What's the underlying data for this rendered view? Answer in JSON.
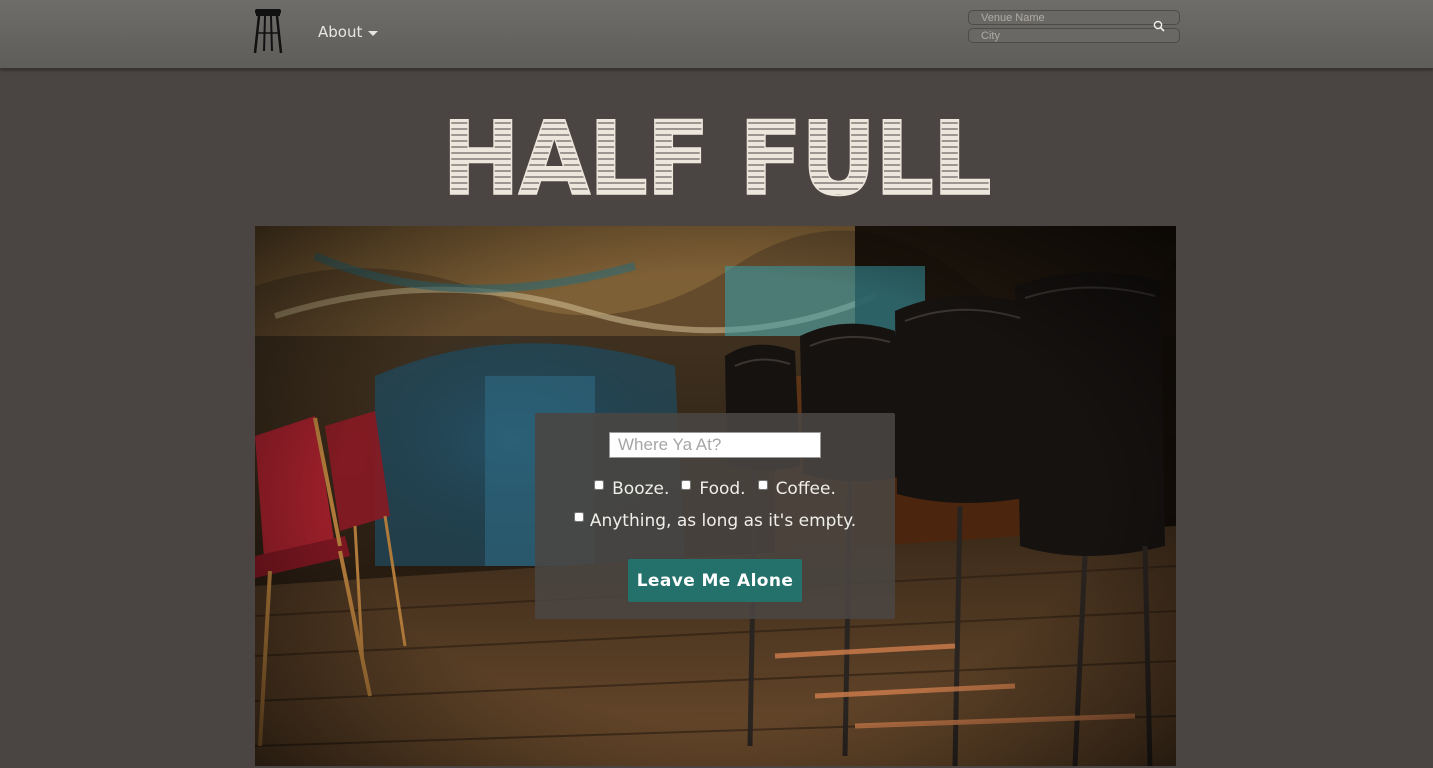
{
  "nav": {
    "about_label": "About",
    "venue_placeholder": "Venue Name",
    "city_placeholder": "City"
  },
  "site": {
    "title": "HALF FULL"
  },
  "form": {
    "location_placeholder": "Where Ya At?",
    "options": [
      "Booze.",
      "Food.",
      "Coffee."
    ],
    "any_option": "Anything, as long as it's empty.",
    "submit_label": "Leave Me Alone"
  },
  "colors": {
    "background": "#4a4542",
    "navbar": "#6a6865",
    "title": "#ece6dc",
    "button": "#24706b"
  },
  "icons": {
    "logo": "bar-stool-icon",
    "search": "search-icon",
    "caret": "caret-down-icon"
  }
}
